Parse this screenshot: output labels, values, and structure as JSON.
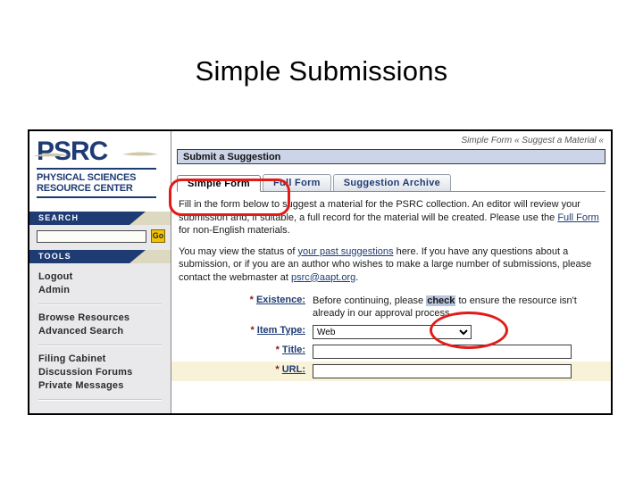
{
  "slide": {
    "title": "Simple Submissions"
  },
  "site": {
    "logo_acronym": "PSRC",
    "logo_line1": "PHYSICAL SCIENCES",
    "logo_line2": "RESOURCE CENTER"
  },
  "sidebar": {
    "search_panel": {
      "heading": "SEARCH",
      "input_value": "",
      "input_placeholder": "",
      "go_label": "Go"
    },
    "tools_panel": {
      "heading": "TOOLS",
      "groups": [
        {
          "items": [
            {
              "label": "Logout"
            },
            {
              "label": "Admin"
            }
          ]
        },
        {
          "items": [
            {
              "label": "Browse Resources"
            },
            {
              "label": "Advanced Search"
            }
          ]
        },
        {
          "items": [
            {
              "label": "Filing Cabinet"
            },
            {
              "label": "Discussion Forums"
            },
            {
              "label": "Private Messages"
            }
          ]
        }
      ]
    }
  },
  "main": {
    "breadcrumb": "Simple Form « Suggest a Material «",
    "page_header": "Submit a Suggestion",
    "tabs": [
      {
        "label": "Simple Form",
        "active": true
      },
      {
        "label": "Full Form",
        "active": false
      },
      {
        "label": "Suggestion Archive",
        "active": false
      }
    ],
    "paragraph1": {
      "part1": "Fill in the form below to suggest a material for the PSRC collection. An editor will review your submission and, if suitable, a full record for the material will be created. Please use the ",
      "link": "Full Form",
      "part2": " for non-English materials."
    },
    "paragraph2": {
      "part1": "You may view the status of ",
      "link1": "your past suggestions",
      "part2": " here. If you have any questions about a submission, or if you are an author who wishes to make a large number of submissions, please contact the webmaster at ",
      "link2": "psrc@aapt.org",
      "part3": "."
    },
    "form": {
      "star": "*",
      "rows": [
        {
          "label": "Existence:",
          "type": "text",
          "text_before": "Before continuing, please ",
          "highlight": "check",
          "text_after": " to ensure the resource isn't already in our approval process."
        },
        {
          "label": "Item Type:",
          "type": "select",
          "value": "Web",
          "options": [
            "Web"
          ]
        },
        {
          "label": "Title:",
          "type": "input",
          "value": ""
        },
        {
          "label": "URL:",
          "type": "input",
          "value": ""
        }
      ]
    }
  },
  "annotations": {
    "tab_circle": "red-ellipse-simple-form",
    "check_circle": "red-ellipse-check-link"
  },
  "colors": {
    "brand_navy": "#1f3b73",
    "panel_tan": "#ddd8c0",
    "go_yellow": "#f3c200",
    "header_bar_blue": "#ccd5e8",
    "row_alt": "#f7f2d8",
    "annotation_red": "#e01b18"
  }
}
